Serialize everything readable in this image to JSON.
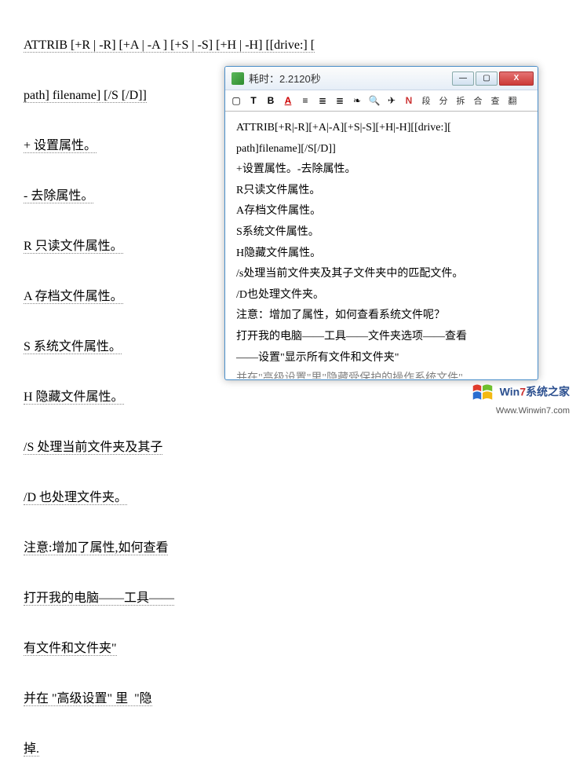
{
  "background": {
    "lines": [
      "ATTRIB [+R | -R] [+A | -A ] [+S | -S] [+H | -H] [[drive:] [",
      "path] filename] [/S [/D]]",
      "+ 设置属性。",
      "- 去除属性。",
      "R 只读文件属性。",
      "A 存档文件属性。",
      "S 系统文件属性。",
      "H 隐藏文件属性。",
      "/S 处理当前文件夹及其子",
      "/D 也处理文件夹。",
      "注意:增加了属性,如何查看",
      "打开我的电脑――工具――",
      "有文件和文件夹\"",
      "并在 \"高级设置\" 里  \"隐",
      "掉."
    ]
  },
  "popup": {
    "title": "耗时：2.2120秒",
    "toolbar": {
      "items": [
        {
          "name": "box-icon",
          "glyph": "▢"
        },
        {
          "name": "text-t",
          "glyph": "T"
        },
        {
          "name": "bold-b",
          "glyph": "B"
        },
        {
          "name": "color-a",
          "glyph": "A"
        },
        {
          "name": "align-left-icon",
          "glyph": "≡"
        },
        {
          "name": "align-center-icon",
          "glyph": "≣"
        },
        {
          "name": "list-icon",
          "glyph": "≣"
        },
        {
          "name": "globe-icon",
          "glyph": "❧"
        },
        {
          "name": "search-icon",
          "glyph": "🔍"
        },
        {
          "name": "send-icon",
          "glyph": "✈"
        },
        {
          "name": "n-icon",
          "glyph": "N"
        },
        {
          "name": "btn-duan",
          "glyph": "段"
        },
        {
          "name": "btn-fen",
          "glyph": "分"
        },
        {
          "name": "btn-chai",
          "glyph": "拆"
        },
        {
          "name": "btn-he",
          "glyph": "合"
        },
        {
          "name": "btn-cha",
          "glyph": "查"
        },
        {
          "name": "btn-fan",
          "glyph": "翻"
        }
      ]
    },
    "body_lines": [
      "ATTRIB[+R|-R][+A|-A][+S|-S][+H|-H][[drive:][",
      "path]filename][/S[/D]]",
      "+设置属性。-去除属性。",
      "R只读文件属性。",
      "A存档文件属性。",
      "S系统文件属性。",
      "H隐藏文件属性。",
      "/s处理当前文件夹及其子文件夹中的匹配文件。",
      "/D也处理文件夹。",
      "注意：增加了属性，如何查看系统文件呢？",
      "打开我的电脑――工具――文件夹选项――查看",
      "――设置\"显示所有文件和文件夹\"",
      "并在\"高级设置\"里\"隐藏受保护的操作系统文件\""
    ]
  },
  "watermark": {
    "brand_pre": "Win",
    "brand_red": "7",
    "brand_post": "系统之家",
    "url": "Www.Winwin7.com"
  },
  "window_buttons": {
    "min": "—",
    "max": "▢",
    "close": "X"
  }
}
